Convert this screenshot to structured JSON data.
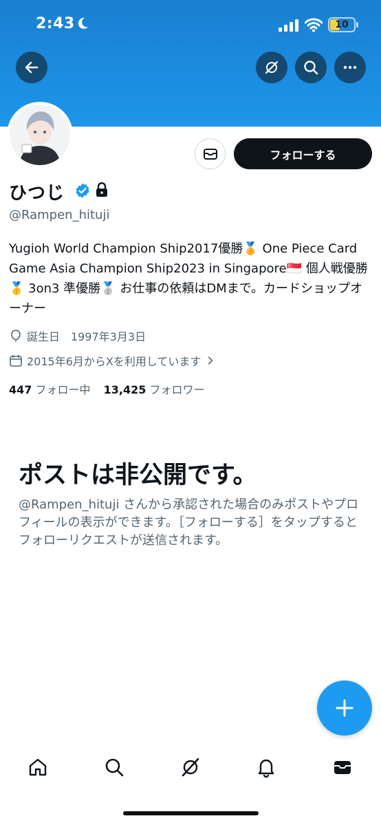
{
  "status_bar": {
    "time": "2:43",
    "battery": "10"
  },
  "header": {
    "back_icon": "arrow-left-icon",
    "grok_icon": "grok-icon",
    "search_icon": "search-icon",
    "more_icon": "more-icon",
    "banner_color": "#1d96ea"
  },
  "profile": {
    "display_name": "ひつじ",
    "handle": "@Rampen_hituji",
    "follow_label": "フォローする",
    "bio": "Yugioh World Champion Ship2017優勝🏅 One Piece Card Game Asia Champion Ship2023 in Singapore🇸🇬 個人戦優勝🥇 3on3 準優勝🥈 お仕事の依頼はDMまで。カードショップオーナー",
    "birthday": "誕生日　1997年3月3日",
    "joined": "2015年6月からXを利用しています",
    "following_count": "447",
    "following_label": "フォロー中",
    "followers_count": "13,425",
    "followers_label": "フォロワー"
  },
  "private_notice": {
    "title": "ポストは非公開です。",
    "body": "@Rampen_hituji さんから承認された場合のみポストやプロフィールの表示ができます。［フォローする］をタップするとフォローリクエストが送信されます。"
  },
  "tabbar": [
    "home-icon",
    "search-icon",
    "grok-icon",
    "notifications-icon",
    "messages-icon"
  ],
  "colors": {
    "accent": "#1d9bf0",
    "text": "#0f1419",
    "secondary": "#536471"
  }
}
